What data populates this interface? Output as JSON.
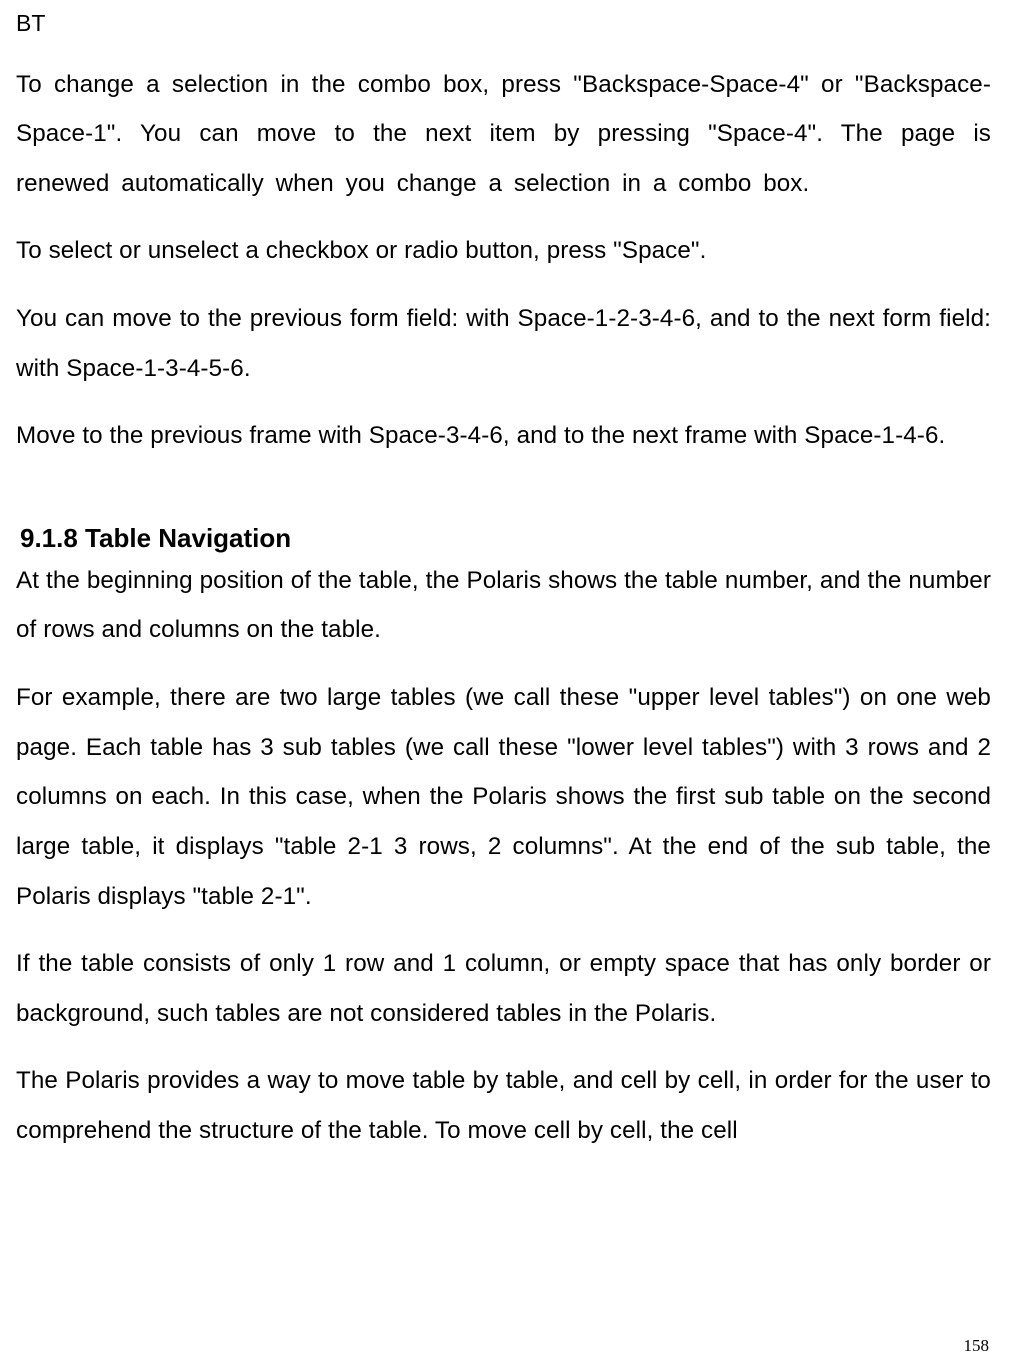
{
  "header": "BT",
  "paragraphs": {
    "p1": "To change a selection in the combo box, press \"Backspace-Space-4\" or \"Backspace-Space-1\". You can move to the next item by pressing \"Space-4\". The page is renewed automatically when you change a selection in a combo box.",
    "p2": "To select or unselect a checkbox or radio button, press \"Space\".",
    "p3": "You can move to the previous form field: with Space-1-2-3-4-6, and to the next form field: with Space-1-3-4-5-6.",
    "p4": "Move to the previous frame with Space-3-4-6, and to the next frame with Space-1-4-6."
  },
  "section": {
    "heading": "9.1.8 Table Navigation",
    "p5": "At the beginning position of the table, the Polaris shows the table number, and the number of rows and columns on the table.",
    "p6": "For example, there are two large tables (we call these \"upper level tables\") on one web page. Each table has 3 sub tables (we call these \"lower level tables\") with 3 rows and 2 columns on each. In this case, when the Polaris shows the first sub table on the second large table, it displays \"table 2-1 3 rows, 2 columns\". At the end of the sub table, the Polaris displays \"table 2-1\".",
    "p7": "If the table consists of only 1 row and 1 column, or empty space that has only border or background, such tables are not considered tables in the Polaris.",
    "p8": "The Polaris provides a way to move table by table, and cell by cell, in order for the user to comprehend the structure of the table. To move cell by cell, the cell"
  },
  "page_number": "158"
}
